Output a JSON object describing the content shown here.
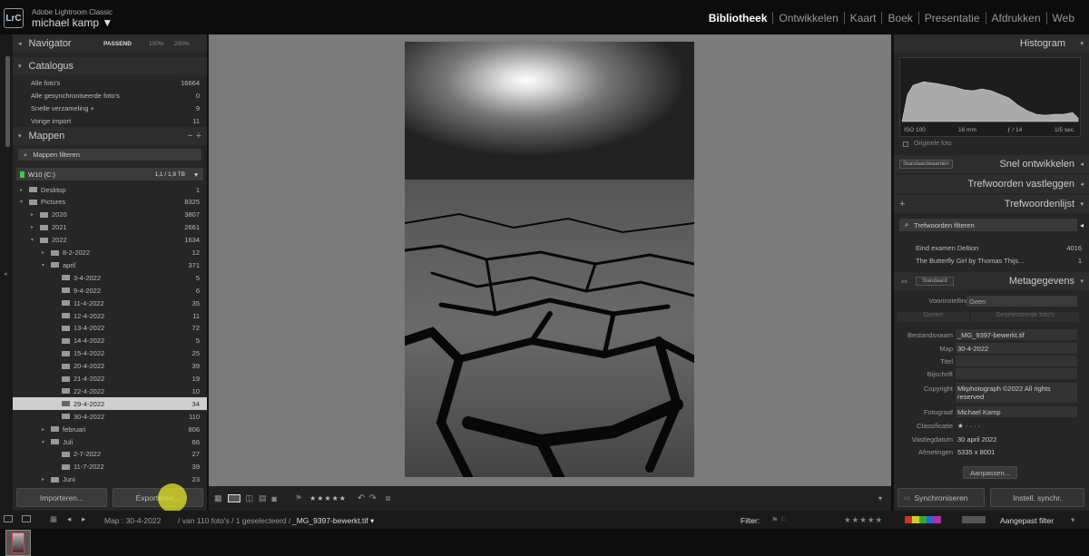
{
  "app": {
    "logo": "LrC",
    "name": "Adobe Lightroom Classic",
    "user": "michael kamp ▼"
  },
  "modules": [
    "Bibliotheek",
    "Ontwikkelen",
    "Kaart",
    "Boek",
    "Presentatie",
    "Afdrukken",
    "Web"
  ],
  "navigator": {
    "title": "Navigator",
    "zoom": [
      "PASSEND",
      "100%",
      "200%"
    ]
  },
  "catalog": {
    "title": "Catalogus",
    "items": [
      {
        "label": "Alle foto's",
        "count": "16664"
      },
      {
        "label": "Alle gesynchroniseerde foto's",
        "count": "0"
      },
      {
        "label": "Snelle verzameling +",
        "count": "9"
      },
      {
        "label": "Vorige import",
        "count": "11"
      }
    ]
  },
  "folders": {
    "title": "Mappen",
    "filter": "Mappen filteren",
    "volume": "W10 (C:)",
    "volume_size": "1,1 / 1,9 TB",
    "items": [
      {
        "label": "Desktop",
        "count": "1"
      },
      {
        "label": "Pictures",
        "count": "8325"
      },
      {
        "label": "2020",
        "count": "3807"
      },
      {
        "label": "2021",
        "count": "2661"
      },
      {
        "label": "2022",
        "count": "1634"
      },
      {
        "label": "8-2-2022",
        "count": "12"
      },
      {
        "label": "april",
        "count": "371"
      },
      {
        "label": "3-4-2022",
        "count": "5"
      },
      {
        "label": "9-4-2022",
        "count": "6"
      },
      {
        "label": "11-4-2022",
        "count": "35"
      },
      {
        "label": "12-4-2022",
        "count": "11"
      },
      {
        "label": "13-4-2022",
        "count": "72"
      },
      {
        "label": "14-4-2022",
        "count": "5"
      },
      {
        "label": "15-4-2022",
        "count": "25"
      },
      {
        "label": "20-4-2022",
        "count": "39"
      },
      {
        "label": "21-4-2022",
        "count": "19"
      },
      {
        "label": "22-4-2022",
        "count": "10"
      },
      {
        "label": "29-4-2022",
        "count": "34"
      },
      {
        "label": "30-4-2022",
        "count": "110"
      },
      {
        "label": "februari",
        "count": "806"
      },
      {
        "label": "Juli",
        "count": "66"
      },
      {
        "label": "2-7-2022",
        "count": "27"
      },
      {
        "label": "11-7-2022",
        "count": "39"
      },
      {
        "label": "Juni",
        "count": "23"
      }
    ]
  },
  "buttons": {
    "import": "Importeren...",
    "export": "Exporteren..."
  },
  "histogram": {
    "title": "Histogram",
    "iso": "ISO 100",
    "focal": "16 mm",
    "aperture": "ƒ / 14",
    "shutter": "1/5 sec.",
    "original": "Originele foto"
  },
  "quick_develop": {
    "preset": "Standaardwaarden",
    "title": "Snel ontwikkelen"
  },
  "keywording": {
    "title": "Trefwoorden vastleggen"
  },
  "keyword_list": {
    "title": "Trefwoordenlijst",
    "filter": "Trefwoorden filteren",
    "items": [
      {
        "label": "Eind examen Deltion",
        "count": "4016"
      },
      {
        "label": "The Butterfly Girl by Thomas Thijs...",
        "count": "1"
      }
    ]
  },
  "metadata": {
    "title": "Metagegevens",
    "preset_select": "Standaard",
    "preset_label": "Voorinstelling",
    "preset_value": "Geen",
    "tabs": [
      "Doelen",
      "Geselecteerde foto's"
    ],
    "fields": [
      {
        "label": "Bestandsnaam",
        "value": "_MG_9397-bewerkt.tif"
      },
      {
        "label": "Map",
        "value": "30-4-2022"
      },
      {
        "label": "Titel",
        "value": ""
      },
      {
        "label": "Bijschrift",
        "value": ""
      },
      {
        "label": "Copyright",
        "value": "Mkphotograph ©2022 All rights reserved"
      },
      {
        "label": "Fotograaf",
        "value": "Michael Kamp"
      },
      {
        "label": "Classificatie",
        "value": "★ · · · ·"
      },
      {
        "label": "Vastlegdatum",
        "value": "30 april 2022"
      },
      {
        "label": "Afmetingen",
        "value": "5335 x 8001"
      }
    ],
    "customize": "Aanpassen..."
  },
  "sync": {
    "sync": "Synchroniseren",
    "settings": "Instell. synchr."
  },
  "toolbar": {
    "stars": "★★★★★"
  },
  "filmbar": {
    "map": "Map : 30-4-2022",
    "info": "/ van 110 foto's / 1 geselecteerd /",
    "file": "_MG_9397-bewerkt.tif ▾",
    "filter_label": "Filter:",
    "filter_value": "Aangepast filter",
    "stars": "★★★★★"
  },
  "colors": {
    "panel": "#262626",
    "center": "#7b7b7b",
    "selected": "#cfcfcf",
    "accent": "#ffffff"
  }
}
